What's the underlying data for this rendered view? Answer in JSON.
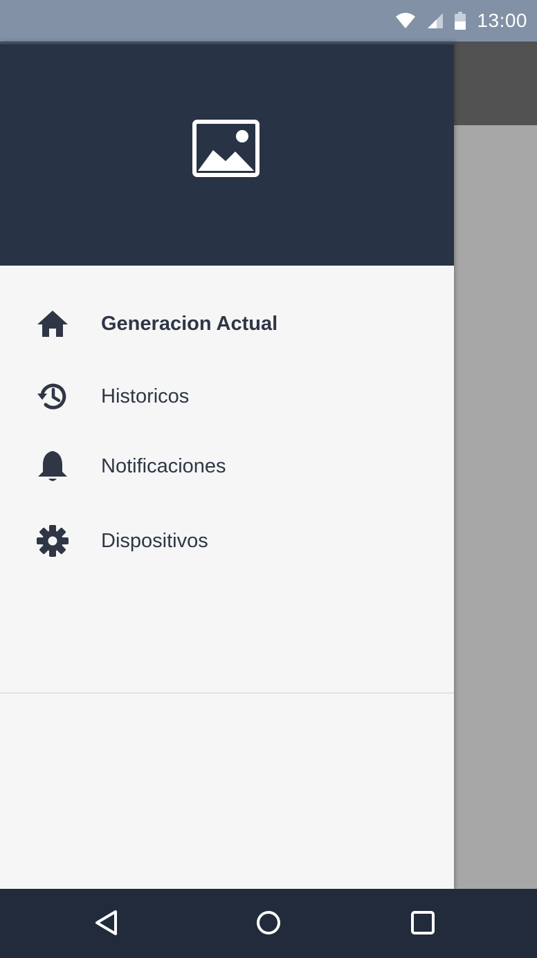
{
  "status_bar": {
    "time": "13:00",
    "icons": [
      "wifi-icon",
      "cell-signal-icon",
      "battery-icon"
    ]
  },
  "drawer": {
    "header": {
      "icon": "image-placeholder-icon",
      "background_color": "#283346"
    },
    "items": [
      {
        "label": "Generacion Actual",
        "icon": "home-icon",
        "active": true
      },
      {
        "label": "Historicos",
        "icon": "history-icon",
        "active": false
      },
      {
        "label": "Notificaciones",
        "icon": "bell-icon",
        "active": false
      },
      {
        "label": "Dispositivos",
        "icon": "gear-icon",
        "active": false
      }
    ]
  },
  "nav_bar": {
    "buttons": [
      "back-icon",
      "home-circle-icon",
      "recents-icon"
    ]
  },
  "colors": {
    "status_bar": "#8291a6",
    "drawer_header": "#283346",
    "drawer_body": "#f6f6f6",
    "text": "#2f3646",
    "nav_bar": "#212b3b",
    "scrim": "#a7a7a7"
  }
}
